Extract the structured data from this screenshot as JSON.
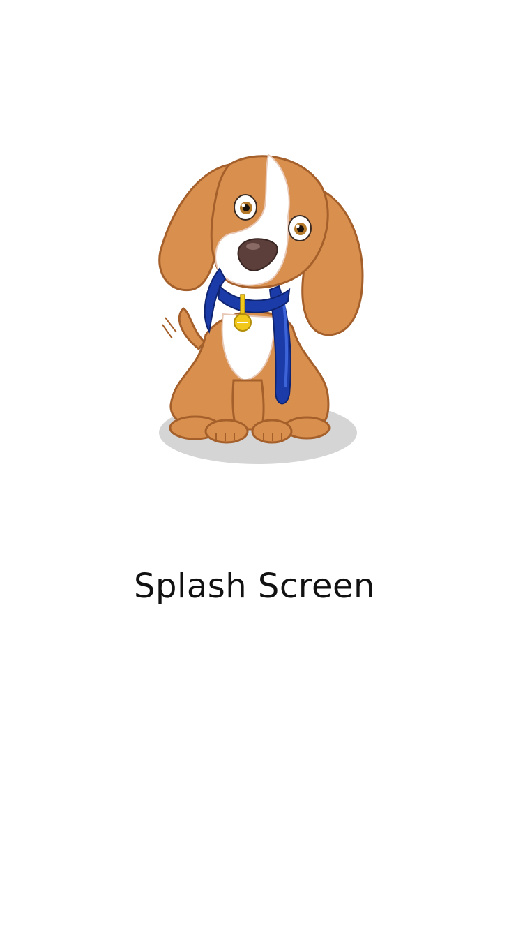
{
  "app": {
    "title": "Splash Screen",
    "mascot_icon": "puppy-with-leash-icon"
  },
  "colors": {
    "background": "#ffffff",
    "text": "#111111",
    "fur": "#d9904f",
    "fur_dark": "#a45f2a",
    "fur_light": "#f6dccb",
    "white_patch": "#ffffff",
    "nose": "#5c3e3a",
    "eye_iris": "#b47a2a",
    "leash": "#1b3ba8",
    "leash_light": "#3d63d8",
    "tag": "#f2c91a",
    "shadow": "#d5d5d5"
  }
}
